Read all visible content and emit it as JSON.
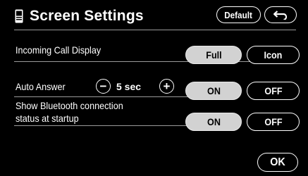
{
  "header": {
    "title": "Screen Settings",
    "default_label": "Default",
    "back_icon": "back-arrow-icon",
    "settings_icon": "phone-settings-icon"
  },
  "settings": {
    "incoming_call_display": {
      "label": "Incoming Call Display",
      "options": [
        "Full",
        "Icon"
      ],
      "selected": "Full"
    },
    "auto_answer": {
      "label": "Auto Answer",
      "minus": "−",
      "value": "5 sec",
      "plus": "+",
      "options": [
        "ON",
        "OFF"
      ],
      "selected": "ON"
    },
    "bluetooth_status": {
      "label_line1": "Show Bluetooth connection",
      "label_line2": "status at startup",
      "options": [
        "ON",
        "OFF"
      ],
      "selected": "ON"
    }
  },
  "footer": {
    "ok_label": "OK"
  },
  "colors": {
    "background": "#000000",
    "selected_fill": "#d2d2d2",
    "border": "#ffffff"
  }
}
